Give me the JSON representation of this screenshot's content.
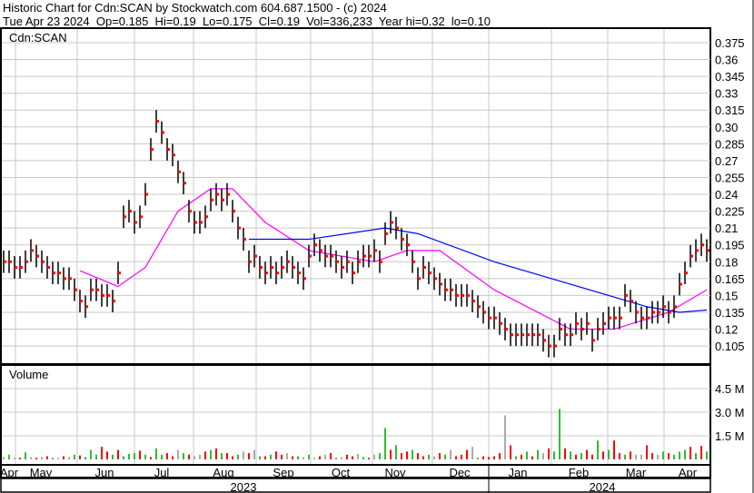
{
  "header": {
    "title": "Historic Chart for Cdn:SCAN by Stockwatch.com 604.687.1500 - (c) 2024",
    "quote": "Tue Apr 23 2024  Op=0.185  Hi=0.19  Lo=0.175  Cl=0.19  Vol=336,233  Year hi=0.32  lo=0.10"
  },
  "colors": {
    "bar": "#000000",
    "close_tick": "#ff0000",
    "ma_short": "#ff00ff",
    "ma_long": "#0000ff",
    "vol_up": "#33bb33",
    "vol_down": "#ff0000",
    "vol_flat": "#aaaaaa",
    "grid": "#c8c8c8"
  },
  "chart_data": {
    "type": "ohlc",
    "symbol": "Cdn:SCAN",
    "price_axis": {
      "ticks": [
        "0.375",
        "0.36",
        "0.345",
        "0.33",
        "0.315",
        "0.30",
        "0.285",
        "0.27",
        "0.255",
        "0.24",
        "0.225",
        "0.21",
        "0.195",
        "0.18",
        "0.165",
        "0.15",
        "0.135",
        "0.12",
        "0.105"
      ],
      "ylim": [
        0.09,
        0.39
      ]
    },
    "typical_range": 0.02,
    "closes": [
      0.18,
      0.18,
      0.175,
      0.175,
      0.18,
      0.19,
      0.185,
      0.18,
      0.175,
      0.17,
      0.17,
      0.165,
      0.165,
      0.155,
      0.145,
      0.14,
      0.155,
      0.155,
      0.15,
      0.15,
      0.145,
      0.17,
      0.22,
      0.225,
      0.215,
      0.22,
      0.24,
      0.28,
      0.305,
      0.295,
      0.28,
      0.275,
      0.26,
      0.25,
      0.225,
      0.215,
      0.215,
      0.22,
      0.235,
      0.24,
      0.235,
      0.24,
      0.225,
      0.21,
      0.2,
      0.18,
      0.185,
      0.175,
      0.17,
      0.175,
      0.17,
      0.175,
      0.18,
      0.175,
      0.17,
      0.165,
      0.185,
      0.195,
      0.19,
      0.185,
      0.185,
      0.18,
      0.175,
      0.18,
      0.17,
      0.18,
      0.185,
      0.185,
      0.19,
      0.18,
      0.205,
      0.215,
      0.21,
      0.2,
      0.195,
      0.18,
      0.165,
      0.175,
      0.17,
      0.165,
      0.16,
      0.155,
      0.155,
      0.15,
      0.15,
      0.15,
      0.145,
      0.14,
      0.135,
      0.13,
      0.13,
      0.125,
      0.12,
      0.115,
      0.115,
      0.115,
      0.115,
      0.115,
      0.115,
      0.11,
      0.105,
      0.105,
      0.12,
      0.115,
      0.115,
      0.125,
      0.12,
      0.125,
      0.11,
      0.12,
      0.125,
      0.13,
      0.13,
      0.13,
      0.15,
      0.145,
      0.135,
      0.13,
      0.13,
      0.135,
      0.135,
      0.14,
      0.135,
      0.14,
      0.16,
      0.17,
      0.185,
      0.19,
      0.195,
      0.19
    ],
    "ma_short": [
      [
        14,
        0.172
      ],
      [
        21,
        0.158
      ],
      [
        26,
        0.175
      ],
      [
        32,
        0.225
      ],
      [
        38,
        0.245
      ],
      [
        42,
        0.245
      ],
      [
        48,
        0.215
      ],
      [
        56,
        0.19
      ],
      [
        68,
        0.18
      ],
      [
        74,
        0.19
      ],
      [
        80,
        0.19
      ],
      [
        90,
        0.155
      ],
      [
        104,
        0.12
      ],
      [
        112,
        0.12
      ],
      [
        122,
        0.135
      ],
      [
        129,
        0.155
      ]
    ],
    "ma_long": [
      [
        45,
        0.2
      ],
      [
        56,
        0.2
      ],
      [
        70,
        0.21
      ],
      [
        76,
        0.205
      ],
      [
        90,
        0.18
      ],
      [
        104,
        0.16
      ],
      [
        118,
        0.14
      ],
      [
        124,
        0.135
      ],
      [
        129,
        0.137
      ]
    ],
    "volume": {
      "label": "Volume",
      "ticks": [
        "4.5 M",
        "3.0 M",
        "1.5 M"
      ],
      "tick_values": [
        4.5,
        3.0,
        1.5
      ],
      "values_m": [
        0.15,
        0.3,
        0.1,
        0.1,
        0.45,
        0.15,
        0.1,
        0.15,
        0.2,
        0.1,
        0.1,
        0.2,
        0.15,
        0.3,
        0.25,
        0.15,
        0.6,
        0.3,
        0.8,
        0.5,
        0.3,
        0.6,
        0.2,
        0.35,
        0.4,
        0.55,
        0.3,
        0.15,
        0.7,
        0.3,
        0.4,
        0.2,
        0.6,
        0.4,
        0.3,
        0.2,
        0.3,
        0.5,
        0.6,
        0.7,
        0.4,
        0.4,
        0.2,
        0.3,
        0.5,
        0.4,
        0.6,
        0.2,
        0.2,
        0.3,
        0.5,
        0.3,
        0.4,
        0.2,
        0.2,
        0.15,
        0.3,
        0.1,
        0.2,
        0.3,
        0.4,
        0.1,
        0.15,
        0.3,
        0.2,
        0.35,
        0.15,
        0.1,
        0.3,
        0.4,
        2.0,
        0.6,
        0.9,
        0.4,
        0.5,
        0.6,
        0.4,
        0.2,
        0.3,
        0.2,
        0.4,
        0.3,
        0.6,
        0.2,
        0.3,
        0.6,
        0.8,
        0.1,
        0.2,
        0.15,
        0.2,
        0.4,
        2.8,
        0.9,
        0.2,
        0.3,
        0.5,
        0.2,
        0.6,
        0.4,
        0.7,
        0.5,
        3.2,
        0.7,
        0.5,
        0.3,
        0.4,
        0.6,
        0.3,
        1.2,
        0.5,
        0.6,
        1.2,
        0.4,
        0.3,
        0.5,
        0.3,
        0.3,
        0.9,
        0.4,
        0.3,
        0.5,
        0.4,
        0.3,
        0.5,
        0.6,
        0.8,
        0.4,
        0.85,
        0.5
      ],
      "direction": "ngnrgnrnrgnrngrgggrrgrgggrgrggrrngrnnrgrgrrgnrngrgrrnrgngnrnrgnrrngrnggrgrrgrrgnrgnrrrngrrrrnrgrgrgnrggrgrgrrgrgrrgrnnrrngrgggrgrg"
    },
    "x_axis": {
      "months": [
        "Apr",
        "May",
        "Jun",
        "Jul",
        "Aug",
        "Sep",
        "Oct",
        "Nov",
        "Dec",
        "Jan",
        "Feb",
        "Mar",
        "Apr"
      ],
      "years": [
        "2023",
        "2024"
      ]
    }
  }
}
